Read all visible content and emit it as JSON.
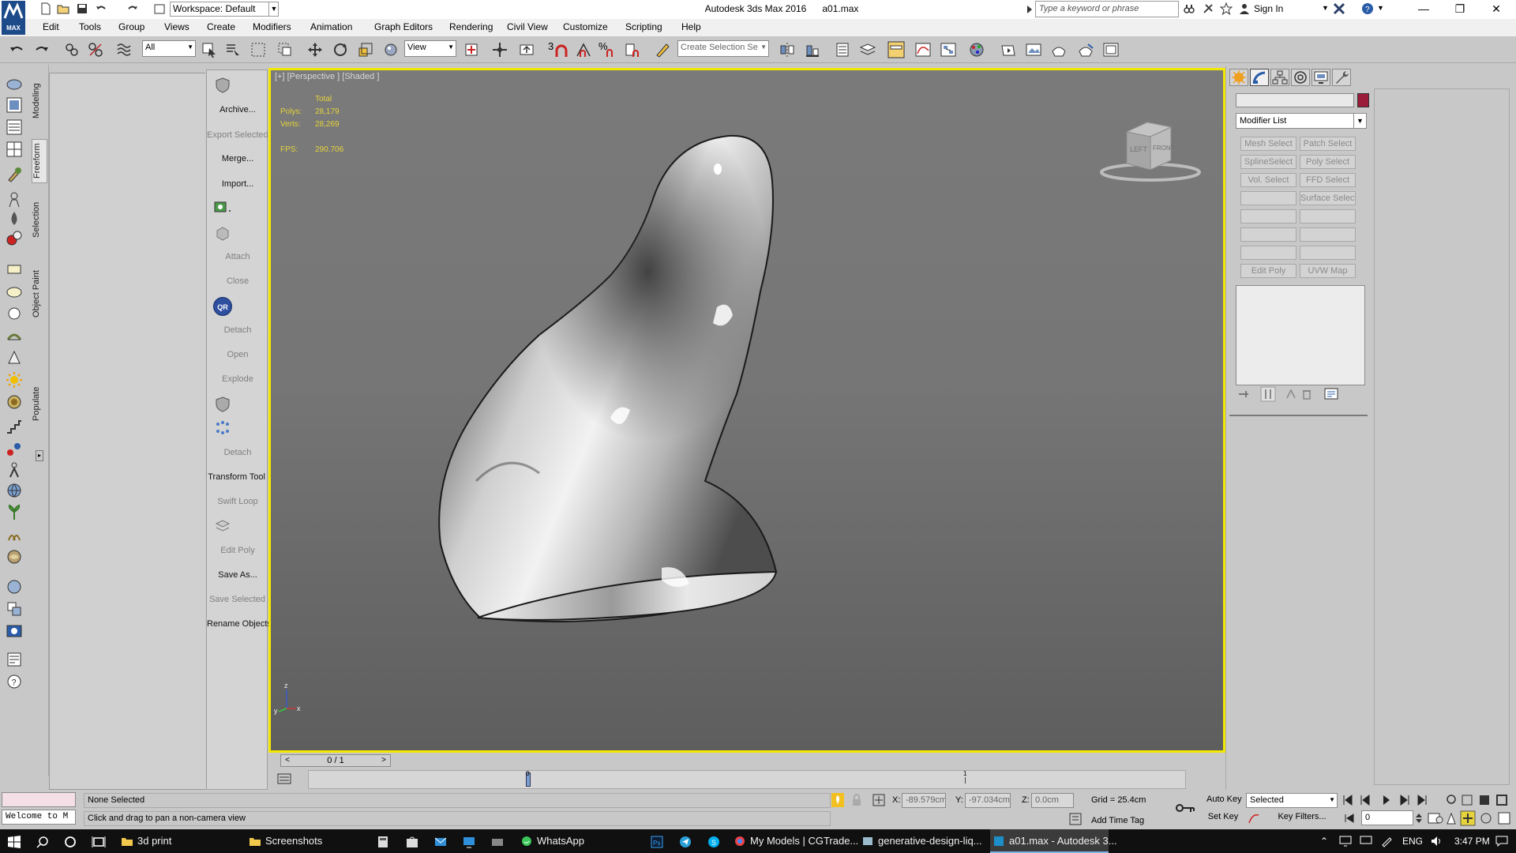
{
  "app": {
    "title": "Autodesk 3ds Max 2016      a01.max",
    "logo_label": "MAX",
    "workspace": "Workspace: Default",
    "search_placeholder": "Type a keyword or phrase",
    "sign_in": "Sign In"
  },
  "menu": [
    "Edit",
    "Tools",
    "Group",
    "Views",
    "Create",
    "Modifiers",
    "Animation",
    "Graph Editors",
    "Rendering",
    "Civil View",
    "Customize",
    "Scripting",
    "Help"
  ],
  "toolbar": {
    "filter_value": "All",
    "coord_value": "View",
    "selection_set_placeholder": "Create Selection Se",
    "snap_label": "3",
    "percent_label": "%"
  },
  "ribbon_tabs": [
    "Modeling",
    "Freeform",
    "Selection",
    "Object Paint",
    "Populate"
  ],
  "graphite_panel": [
    {
      "label": "Archive...",
      "enabled": true
    },
    {
      "label": "Export Selected",
      "enabled": false
    },
    {
      "label": "Merge...",
      "enabled": true
    },
    {
      "label": "Import...",
      "enabled": true
    },
    {
      "label": "Attach",
      "enabled": false
    },
    {
      "label": "Close",
      "enabled": false
    },
    {
      "label": "Detach",
      "enabled": false
    },
    {
      "label": "Open",
      "enabled": false
    },
    {
      "label": "Explode",
      "enabled": false
    },
    {
      "label": "Detach",
      "enabled": false
    },
    {
      "label": "Transform Tool",
      "enabled": true
    },
    {
      "label": "Swift Loop",
      "enabled": false
    },
    {
      "label": "Edit Poly",
      "enabled": false
    },
    {
      "label": "Save As...",
      "enabled": true
    },
    {
      "label": "Save Selected",
      "enabled": false
    },
    {
      "label": "Rename Objects",
      "enabled": true
    }
  ],
  "graphite_badge": "QR",
  "viewport": {
    "label": "[+] [Perspective ] [Shaded ]",
    "stats": {
      "total_label": "Total",
      "polys_label": "Polys:",
      "polys_value": "28,179",
      "verts_label": "Verts:",
      "verts_value": "28,269",
      "fps_label": "FPS:",
      "fps_value": "290.706"
    },
    "viewcube": {
      "left": "LEFT",
      "front": "FRONT"
    },
    "axis": {
      "x": "x",
      "y": "y",
      "z": "z"
    }
  },
  "command_panel": {
    "modifier_list": "Modifier List",
    "modifier_buttons": [
      "Mesh Select",
      "Patch Select",
      "SplineSelect",
      "Poly Select",
      "Vol. Select",
      "FFD Select",
      "",
      "Surface Select",
      "",
      "",
      "",
      "",
      "",
      "",
      "Edit Poly",
      "UVW Map"
    ]
  },
  "timeline": {
    "frame_counter": "0 / 1",
    "prev": "<",
    "next": ">",
    "tick_0": "0",
    "tick_1": "1"
  },
  "status": {
    "selection": "None Selected",
    "prompt": "Click and drag to pan a non-camera view",
    "maxscript": "Welcome to M",
    "x_label": "X:",
    "x_value": "-89.579cm",
    "y_label": "Y:",
    "y_value": "-97.034cm",
    "z_label": "Z:",
    "z_value": "0.0cm",
    "grid": "Grid = 25.4cm",
    "add_time_tag": "Add Time Tag",
    "auto_key": "Auto Key",
    "set_key": "Set Key",
    "key_mode": "Selected",
    "key_filters": "Key Filters...",
    "frame_value": "0"
  },
  "taskbar": {
    "items": [
      "3d print",
      "Screenshots",
      "WhatsApp",
      "My Models | CGTrade...",
      "generative-design-liq...",
      "a01.max - Autodesk 3..."
    ],
    "language": "ENG",
    "time": "3:47 PM"
  },
  "colors": {
    "viewport_border": "#f3e800",
    "stats_text": "#e6d33a",
    "object_color": "#9a1b3a",
    "accent": "#1f5fbf"
  }
}
